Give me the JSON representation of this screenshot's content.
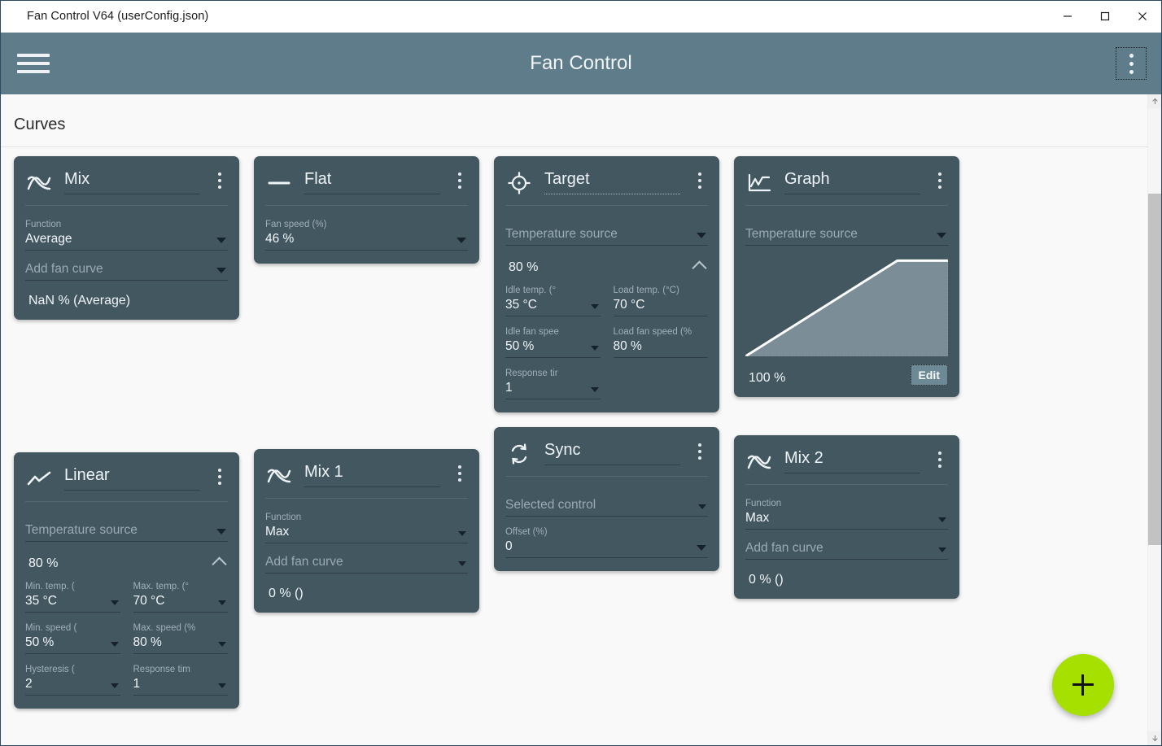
{
  "window": {
    "title": "Fan Control V64 (userConfig.json)",
    "minimize_label": "Minimize",
    "maximize_label": "Maximize",
    "close_label": "Close"
  },
  "appbar": {
    "title": "Fan Control",
    "menu_icon": "hamburger-icon",
    "overflow_icon": "kebab-menu-icon"
  },
  "page": {
    "section_title": "Curves",
    "add_button_label": "+",
    "colors": {
      "appbar": "#5f7c8a",
      "card": "#435761",
      "page_background": "#f9f9f9",
      "fab_accent": "#a6e000",
      "edit_button": "#6c8995",
      "graph_line": "#ffffff",
      "graph_fill": "#7b8e98"
    }
  },
  "cards": [
    {
      "id": "mix",
      "icon": "mix-curve-icon",
      "title": "Mix",
      "underline_style": "solid",
      "fields": [
        {
          "name": "function",
          "label": "Function",
          "value": "Average",
          "caret": true,
          "placeholder": false
        },
        {
          "name": "add-fan-curve",
          "label": "",
          "value": "Add fan curve",
          "caret": true,
          "placeholder": true
        }
      ],
      "summary": "NaN % (Average)"
    },
    {
      "id": "flat",
      "icon": "flat-curve-icon",
      "title": "Flat",
      "underline_style": "solid",
      "fields": [
        {
          "name": "fan-speed",
          "label": "Fan speed (%)",
          "value": "46 %",
          "caret": true,
          "placeholder": false
        }
      ],
      "summary": ""
    },
    {
      "id": "target",
      "icon": "target-curve-icon",
      "title": "Target",
      "underline_style": "dotted",
      "fields": [
        {
          "name": "temperature-source",
          "label": "",
          "value": "Temperature source",
          "caret": true,
          "placeholder": true
        }
      ],
      "expander": {
        "value": "80 %",
        "expanded": true
      },
      "detail_fields": [
        {
          "name": "idle-temp",
          "label": "Idle temp. (°",
          "value": "35 °C",
          "caret": true
        },
        {
          "name": "load-temp",
          "label": "Load temp. (°C)",
          "value": "70 °C",
          "caret": false
        },
        {
          "name": "idle-fan-speed",
          "label": "Idle fan spee",
          "value": "50 %",
          "caret": true
        },
        {
          "name": "load-fan-speed",
          "label": "Load fan speed (%",
          "value": "80 %",
          "caret": false
        },
        {
          "name": "response-time",
          "label": "Response tir",
          "value": "1",
          "caret": true
        }
      ]
    },
    {
      "id": "graph",
      "icon": "graph-curve-icon",
      "title": "Graph",
      "underline_style": "solid",
      "fields": [
        {
          "name": "temperature-source",
          "label": "",
          "value": "Temperature source",
          "caret": true,
          "placeholder": true
        }
      ],
      "graph_percent": "100 %",
      "edit_label": "Edit"
    },
    {
      "id": "linear",
      "icon": "linear-curve-icon",
      "title": "Linear",
      "underline_style": "solid",
      "fields": [
        {
          "name": "temperature-source",
          "label": "",
          "value": "Temperature source",
          "caret": true,
          "placeholder": true
        }
      ],
      "expander": {
        "value": "80 %",
        "expanded": true
      },
      "detail_fields": [
        {
          "name": "min-temp",
          "label": "Min. temp. (",
          "value": "35 °C",
          "caret": true
        },
        {
          "name": "max-temp",
          "label": "Max. temp. (°",
          "value": "70 °C",
          "caret": true
        },
        {
          "name": "min-speed",
          "label": "Min. speed (",
          "value": "50 %",
          "caret": true
        },
        {
          "name": "max-speed",
          "label": "Max. speed (%",
          "value": "80 %",
          "caret": true
        },
        {
          "name": "hysteresis",
          "label": "Hysteresis (",
          "value": "2",
          "caret": true
        },
        {
          "name": "response-time",
          "label": "Response tim",
          "value": "1",
          "caret": true
        }
      ]
    },
    {
      "id": "mix1",
      "icon": "mix-curve-icon",
      "title": "Mix 1",
      "underline_style": "solid",
      "fields": [
        {
          "name": "function",
          "label": "Function",
          "value": "Max",
          "caret": true,
          "placeholder": false
        },
        {
          "name": "add-fan-curve",
          "label": "",
          "value": "Add fan curve",
          "caret": true,
          "placeholder": true
        }
      ],
      "summary": "0 % ()"
    },
    {
      "id": "sync",
      "icon": "sync-curve-icon",
      "title": "Sync",
      "underline_style": "solid",
      "fields": [
        {
          "name": "selected-control",
          "label": "",
          "value": "Selected control",
          "caret": true,
          "placeholder": true
        },
        {
          "name": "offset",
          "label": "Offset (%)",
          "value": "0",
          "caret": true,
          "placeholder": false
        }
      ],
      "summary": ""
    },
    {
      "id": "mix2",
      "icon": "mix-curve-icon",
      "title": "Mix 2",
      "underline_style": "solid",
      "fields": [
        {
          "name": "function",
          "label": "Function",
          "value": "Max",
          "caret": true,
          "placeholder": false
        },
        {
          "name": "add-fan-curve",
          "label": "",
          "value": "Add fan curve",
          "caret": true,
          "placeholder": true
        }
      ],
      "summary": "0 % ()"
    }
  ],
  "graph_chart": {
    "type": "line",
    "title": "Graph curve",
    "x": [
      0,
      75,
      100
    ],
    "y": [
      0,
      100,
      100
    ],
    "xlabel": "",
    "ylabel": "",
    "ylim": [
      0,
      100
    ],
    "xlim": [
      0,
      100
    ],
    "fill": true,
    "grid": false
  },
  "scrollbar": {
    "up_icon": "arrow-up-icon",
    "down_icon": "arrow-down-icon"
  }
}
